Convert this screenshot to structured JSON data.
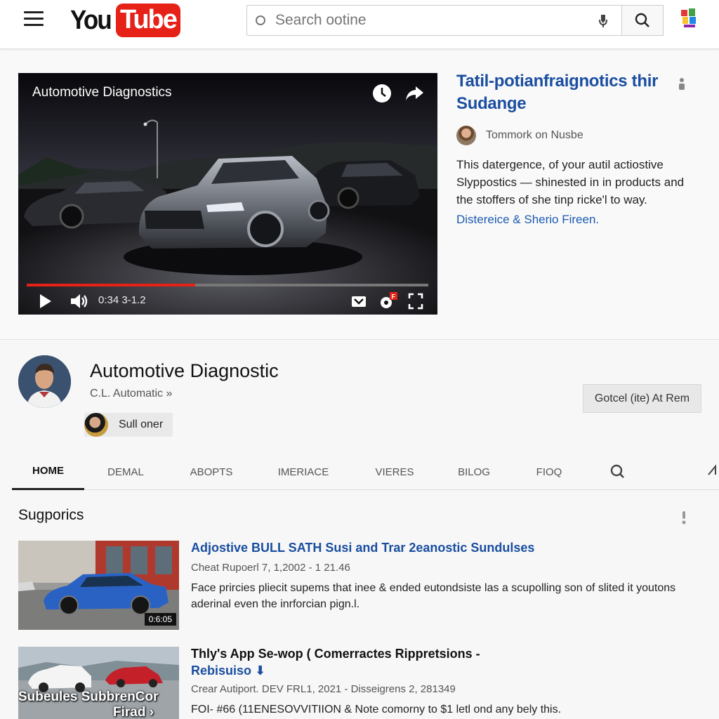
{
  "header": {
    "logo_you": "You",
    "logo_tube": "Tube",
    "search_placeholder": "Search ootine",
    "brand_color": "#e62117"
  },
  "player": {
    "title": "Automotive Diagnostics",
    "time": "0:34 3-1.2",
    "progress_fraction": 0.42,
    "icons": [
      "clock-icon",
      "share-icon",
      "play-icon",
      "volume-icon",
      "captions-icon",
      "settings-icon",
      "fullscreen-icon"
    ]
  },
  "side": {
    "title": "Tatil-potianfraignotics thir Sudange",
    "author": "Tommork on Nusbe",
    "description": "This datergence, of your autil actiostive Slyppostics — shinested in in products and the stoffers of she tinp ricke'l to way.",
    "link": "Distereice & Sherio Fireen."
  },
  "channel": {
    "name": "Automotive Diagnostic",
    "subtitle": "C.L. Automatic »",
    "chip_label": "Sull oner",
    "subscribe_label": "Gotcel (ite) At Rem"
  },
  "tabs": [
    {
      "label": "HOME",
      "active": true
    },
    {
      "label": "DEMAL"
    },
    {
      "label": "ABOPTS"
    },
    {
      "label": "IMERIACE"
    },
    {
      "label": "VIERES"
    },
    {
      "label": "BILOG"
    },
    {
      "label": "FIOQ"
    }
  ],
  "section": {
    "title": "Sugporics"
  },
  "videos": [
    {
      "title": "Adjostive BULL SATH Susi and Trar 2eanostic Sundulses",
      "meta": "Cheat Rupoerl 7, 1,2002 - 1 21.46",
      "description": "Face prircies pliecit supems that inee & ended eutondsiste las a scupolling son of slited it youtons aderinal even the inrforcian pign.l.",
      "duration": "0:6:05"
    },
    {
      "title": "Thly's App Se-wop ( Comerractes Rippretsions -",
      "title2": "Rebisuiso ⬇",
      "meta": "Crear Autiport. DEV FRL1, 2021 - Disseigrens 2, 281349",
      "description": "FOI- #66 (11ENESOVVITIION & Note comorny to $1 letl ond any bely this.",
      "thumb_caption_1": "Subeules SubbrenCor",
      "thumb_caption_2": "Firad ›"
    }
  ]
}
